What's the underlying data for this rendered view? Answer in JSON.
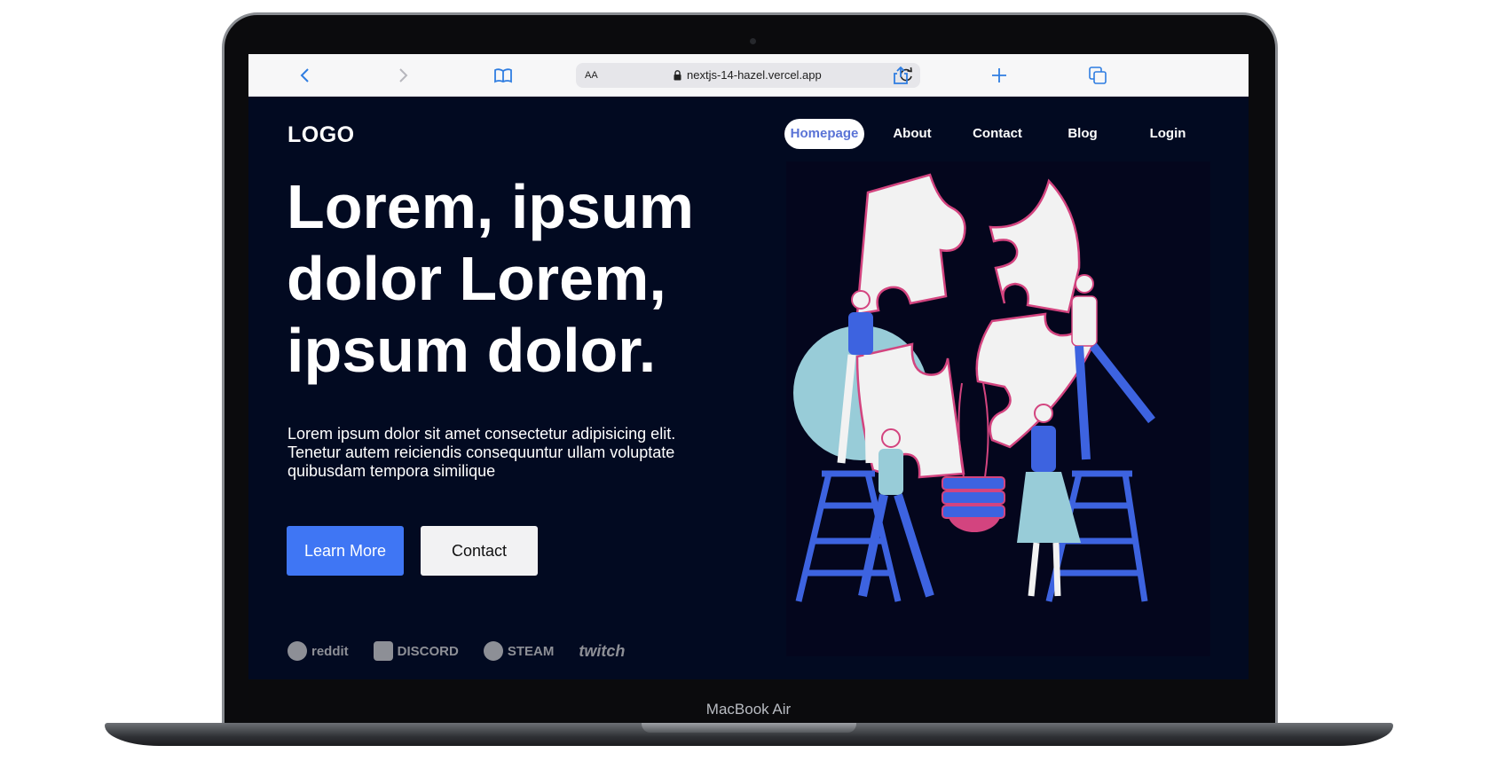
{
  "device": {
    "model_label": "MacBook Air"
  },
  "browser": {
    "text_size_label": "AA",
    "url": "nextjs-14-hazel.vercel.app",
    "icons": [
      "chevron-left-icon",
      "chevron-right-icon",
      "book-icon",
      "lock-icon",
      "reload-icon",
      "share-icon",
      "plus-icon",
      "tabs-icon"
    ]
  },
  "site": {
    "logo": "LOGO",
    "nav": [
      {
        "label": "Homepage",
        "active": true
      },
      {
        "label": "About",
        "active": false
      },
      {
        "label": "Contact",
        "active": false
      },
      {
        "label": "Blog",
        "active": false
      },
      {
        "label": "Login",
        "active": false
      }
    ],
    "hero": {
      "title": "Lorem, ipsum dolor Lorem, ipsum dolor.",
      "description": "Lorem ipsum dolor sit amet consectetur adipisicing elit. Tenetur autem reiciendis consequuntur ullam voluptate quibusdam tempora similique",
      "primary_button": "Learn More",
      "secondary_button": "Contact"
    },
    "brands": [
      "reddit",
      "DISCORD",
      "STEAM",
      "twitch"
    ]
  },
  "colors": {
    "page_background": "#020a21",
    "accent": "#3f76f4",
    "nav_active_text": "#5a73d6",
    "illustration_pink": "#d3447f",
    "illustration_blue": "#3d63e0",
    "illustration_teal": "#98ccd8"
  }
}
